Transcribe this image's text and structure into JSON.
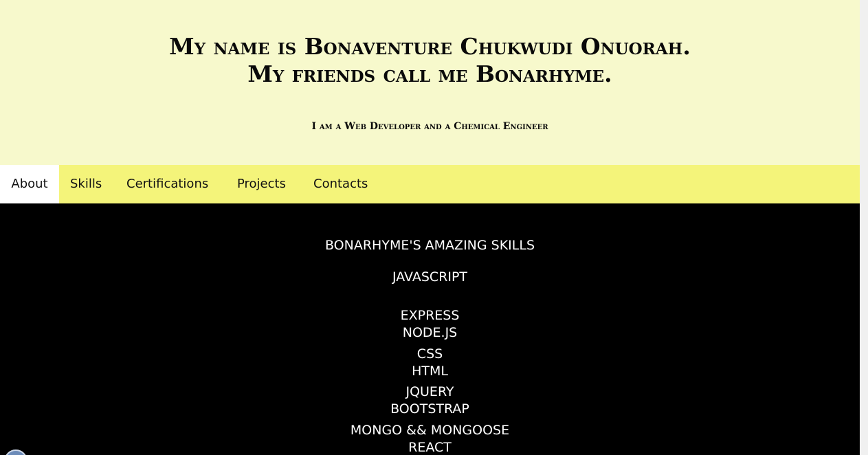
{
  "header": {
    "title_line1": "My name is Bonaventure Chukwudi Onuorah.",
    "title_line2": "My friends call me Bonarhyme.",
    "subtitle": "I am a Web Developer and a Chemical Engineer"
  },
  "nav": {
    "items": [
      {
        "label": "About",
        "active": true
      },
      {
        "label": "Skills",
        "active": false
      },
      {
        "label": "Certifications",
        "active": false
      },
      {
        "label": "Projects",
        "active": false
      },
      {
        "label": "Contacts",
        "active": false
      }
    ]
  },
  "skills": {
    "heading": "BONARHYME'S AMAZING SKILLS",
    "items": [
      "JAVASCRIPT",
      "EXPRESS",
      "NODE.JS",
      "CSS",
      "HTML",
      "JQUERY",
      "BOOTSTRAP",
      "MONGO && MONGOOSE",
      "REACT"
    ]
  },
  "colors": {
    "header_bg": "#f7f9cc",
    "nav_bg": "#f4f47a",
    "active_tab_bg": "#ffffff",
    "content_bg": "#000000",
    "content_text": "#ffffff"
  }
}
